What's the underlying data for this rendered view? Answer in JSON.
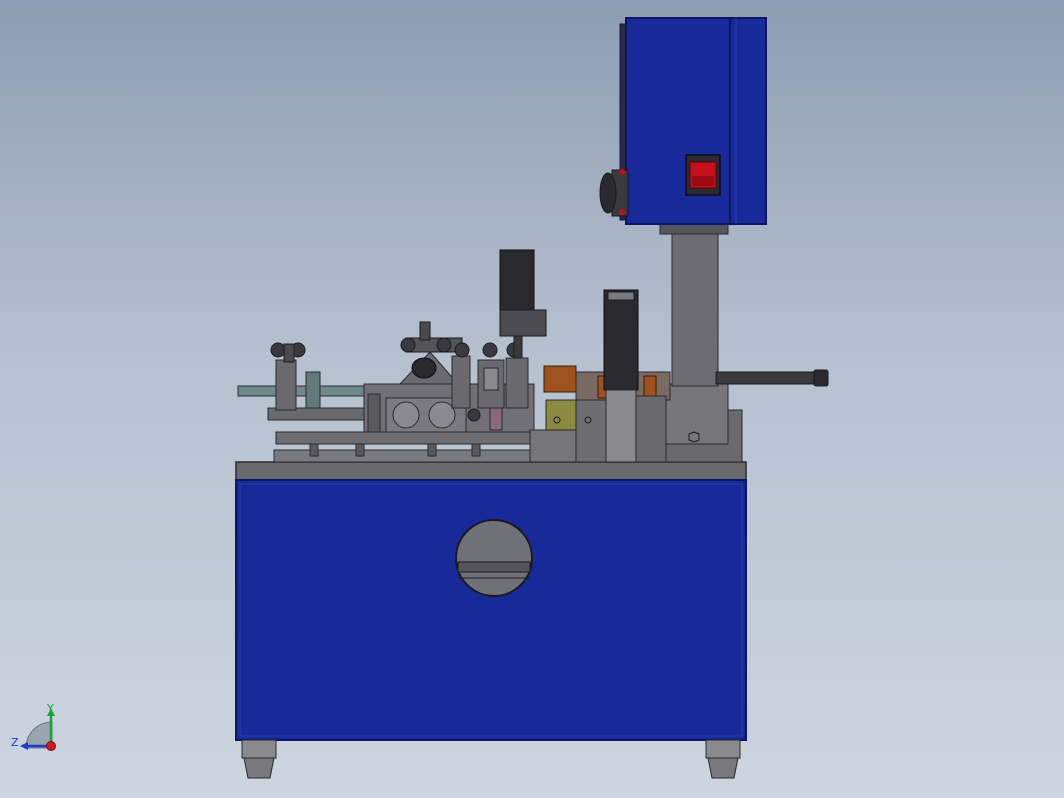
{
  "view": {
    "background_top": "#8e9db3",
    "background_bottom": "#cdd5e0"
  },
  "colors": {
    "cabinet_blue": "#1a2a9a",
    "cabinet_edge": "#0d1660",
    "frame_gray": "#6f6f73",
    "dark_gray": "#3a3a3e",
    "light_gray": "#9a9a9e",
    "switch_red": "#c4101a",
    "copper": "#a0521e",
    "olive": "#8a8a40"
  },
  "triad": {
    "y_label": "Y",
    "z_label": "Z",
    "y_color": "#1aa33a",
    "z_color": "#1a3ad0",
    "origin_color": "#d01a1a"
  }
}
